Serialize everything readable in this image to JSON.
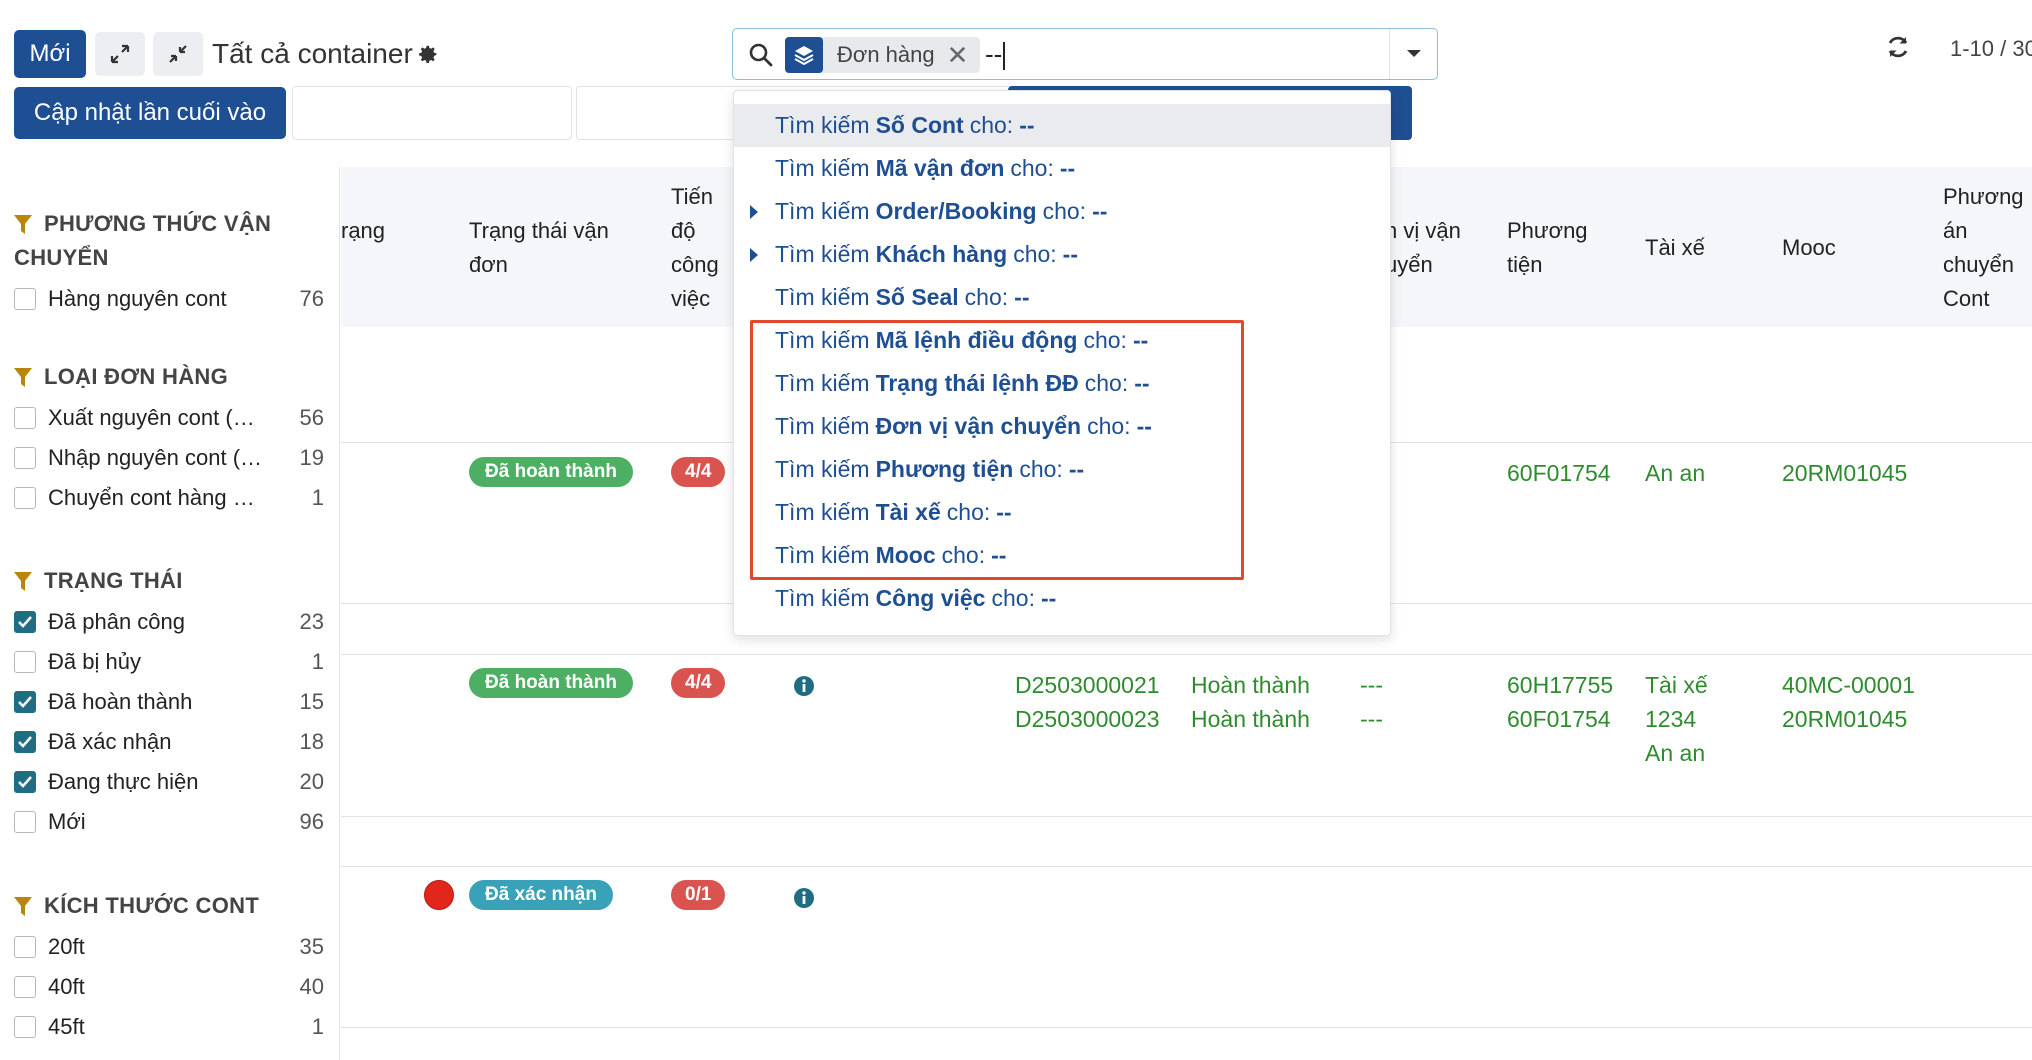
{
  "control": {
    "new_label": "Mới",
    "update_label": "Cập nhật lần cuối vào",
    "view_title": "Tất cả container",
    "pager": "1-10 / 30"
  },
  "search": {
    "facet_label": "Đơn hàng",
    "facet_close": "✕",
    "query": "--"
  },
  "dropdown": {
    "prefix": "Tìm kiếm",
    "suffix": "cho:",
    "items": [
      {
        "field": "Số Cont",
        "expandable": false
      },
      {
        "field": "Mã vận đơn",
        "expandable": false
      },
      {
        "field": "Order/Booking",
        "expandable": true
      },
      {
        "field": "Khách hàng",
        "expandable": true
      },
      {
        "field": "Số Seal",
        "expandable": false
      },
      {
        "field": "Mã lệnh điều động",
        "expandable": false
      },
      {
        "field": "Trạng thái lệnh ĐĐ",
        "expandable": false
      },
      {
        "field": "Đơn vị vận chuyển",
        "expandable": false
      },
      {
        "field": "Phương tiện",
        "expandable": false
      },
      {
        "field": "Tài xế",
        "expandable": false
      },
      {
        "field": "Mooc",
        "expandable": false
      },
      {
        "field": "Công việc",
        "expandable": false
      }
    ]
  },
  "sidebar": {
    "groups": [
      {
        "title_line1": "PHƯƠNG THỨC VẬN",
        "title_line2": "CHUYỂN",
        "items": [
          {
            "label": "Hàng nguyên cont",
            "count": "76",
            "checked": false
          }
        ]
      },
      {
        "title_line1": "LOẠI ĐƠN HÀNG",
        "title_line2": "",
        "items": [
          {
            "label": "Xuất nguyên cont (Export)",
            "count": "56",
            "checked": false
          },
          {
            "label": "Nhập nguyên cont (Import)",
            "count": "19",
            "checked": false
          },
          {
            "label": "Chuyển cont hàng nội địa",
            "count": "1",
            "checked": false
          }
        ]
      },
      {
        "title_line1": "TRẠNG THÁI",
        "title_line2": "",
        "items": [
          {
            "label": "Đã phân công",
            "count": "23",
            "checked": true
          },
          {
            "label": "Đã bị hủy",
            "count": "1",
            "checked": false
          },
          {
            "label": "Đã hoàn thành",
            "count": "15",
            "checked": true
          },
          {
            "label": "Đã xác nhận",
            "count": "18",
            "checked": true
          },
          {
            "label": "Đang thực hiện",
            "count": "20",
            "checked": true
          },
          {
            "label": "Mới",
            "count": "96",
            "checked": false
          }
        ]
      },
      {
        "title_line1": "KÍCH THƯỚC CONT",
        "title_line2": "",
        "items": [
          {
            "label": "20ft",
            "count": "35",
            "checked": false
          },
          {
            "label": "40ft",
            "count": "40",
            "checked": false
          },
          {
            "label": "45ft",
            "count": "1",
            "checked": false
          }
        ]
      }
    ]
  },
  "table": {
    "headers": {
      "status_partial": "rạng",
      "bill_status_1": "Trạng thái vận",
      "bill_status_2": "đơn",
      "progress_1": "Tiến",
      "progress_2": "độ",
      "progress_3": "công",
      "progress_4": "việc",
      "carrier_1": "n vị vận",
      "carrier_2": "uyển",
      "vehicle_1": "Phương",
      "vehicle_2": "tiện",
      "driver": "Tài xế",
      "mooc": "Mooc",
      "plan_1": "Phương",
      "plan_2": "án",
      "plan_3": "chuyển",
      "plan_4": "Cont"
    },
    "rows": [
      {
        "bill_status": "Đã hoàn thành",
        "progress": "4/4",
        "vehicle": "60F01754",
        "driver": "An an",
        "mooc": "20RM01045"
      },
      {
        "bill_status": "Đã hoàn thành",
        "progress": "4/4",
        "orders": [
          "D2503000021",
          "D2503000023"
        ],
        "order_status": [
          "Hoàn thành",
          "Hoàn thành"
        ],
        "carrier": [
          "---",
          "---"
        ],
        "vehicles": [
          "60H17755",
          "60F01754"
        ],
        "drivers": [
          "Tài xế",
          "1234",
          "An an"
        ],
        "moocs": [
          "40MC-00001",
          "20RM01045"
        ]
      },
      {
        "bill_status": "Đã xác nhận",
        "progress": "0/1"
      }
    ]
  },
  "colors": {
    "primary": "#1f4f93",
    "success": "#4caf63",
    "info": "#3aa2b8",
    "danger": "#d9534f",
    "highlight_border": "#e0482f",
    "cell_text": "#2e8b2e",
    "checkbox_checked": "#1f6d82"
  }
}
